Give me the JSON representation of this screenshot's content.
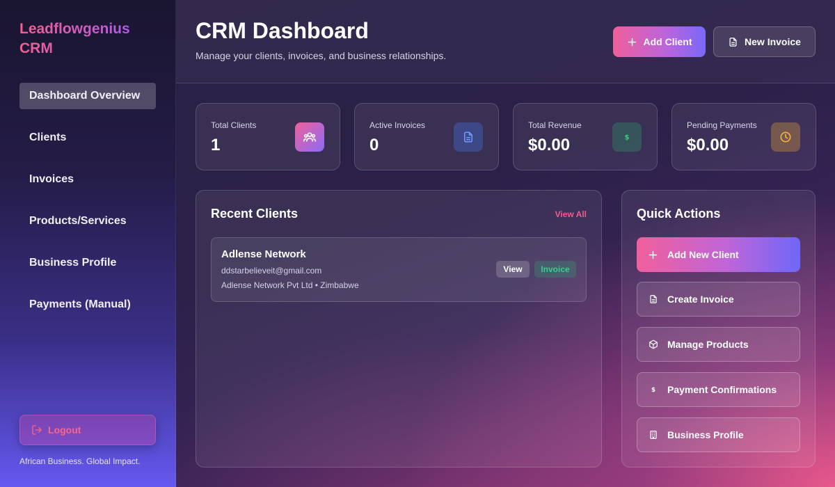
{
  "brand": "Leadflowgenius CRM",
  "sidebar": {
    "items": [
      {
        "label": "Dashboard Overview",
        "active": true
      },
      {
        "label": "Clients"
      },
      {
        "label": "Invoices"
      },
      {
        "label": "Products/Services"
      },
      {
        "label": "Business Profile"
      },
      {
        "label": "Payments (Manual)"
      }
    ],
    "logout_label": "Logout",
    "tagline": "African Business. Global Impact."
  },
  "header": {
    "title": "CRM Dashboard",
    "subtitle": "Manage your clients, invoices, and business relationships.",
    "add_client_label": "Add Client",
    "new_invoice_label": "New Invoice"
  },
  "stats": [
    {
      "label": "Total Clients",
      "value": "1",
      "icon": "users-icon",
      "color": "#e062b8"
    },
    {
      "label": "Active Invoices",
      "value": "0",
      "icon": "document-icon",
      "color": "#4f7df0"
    },
    {
      "label": "Total Revenue",
      "value": "$0.00",
      "icon": "dollar-icon",
      "color": "#2fbf71"
    },
    {
      "label": "Pending Payments",
      "value": "$0.00",
      "icon": "clock-icon",
      "color": "#e0a33a"
    }
  ],
  "recent_clients": {
    "title": "Recent Clients",
    "view_all_label": "View All",
    "clients": [
      {
        "name": "Adlense Network",
        "email": "ddstarbelieveit@gmail.com",
        "company_line": "Adlense Network Pvt Ltd • Zimbabwe",
        "view_label": "View",
        "invoice_label": "Invoice"
      }
    ]
  },
  "quick_actions": {
    "title": "Quick Actions",
    "items": [
      {
        "label": "Add New Client",
        "icon": "plus-icon"
      },
      {
        "label": "Create Invoice",
        "icon": "document-icon"
      },
      {
        "label": "Manage Products",
        "icon": "box-icon"
      },
      {
        "label": "Payment Confirmations",
        "icon": "dollar-icon"
      },
      {
        "label": "Business Profile",
        "icon": "building-icon"
      }
    ]
  },
  "colors": {
    "accent_pink": "#f0609b",
    "accent_violet": "#7a68f8",
    "success": "#35d18a"
  }
}
